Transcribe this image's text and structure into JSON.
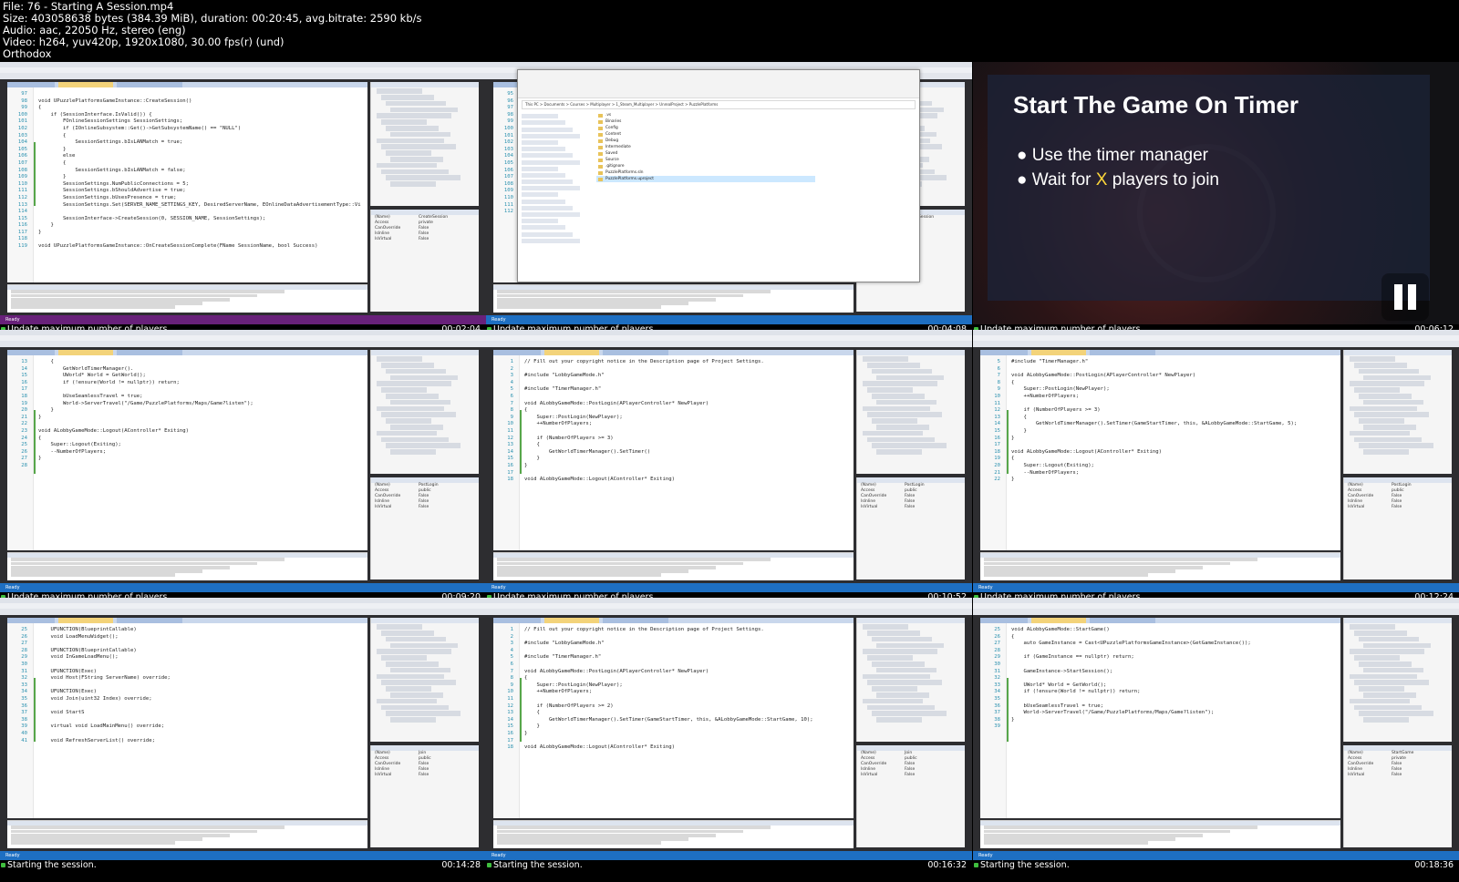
{
  "header": {
    "lines": [
      "File: 76 - Starting A Session.mp4",
      "Size: 403058638 bytes (384.39 MiB), duration: 00:20:45, avg.bitrate: 2590 kb/s",
      "Audio: aac, 22050 Hz, stereo (eng)",
      "Video: h264, yuv420p, 1920x1080, 30.00 fps(r) (und)",
      "Orthodox"
    ]
  },
  "tiles": [
    {
      "caption": "Update maximum number of players.",
      "timestamp": "00:02:04",
      "kind": "vs",
      "status": "Ready",
      "code": [
        {
          "n": "97",
          "t": ""
        },
        {
          "n": "98",
          "t": "void UPuzzlePlatformsGameInstance::CreateSession()"
        },
        {
          "n": "99",
          "t": "{"
        },
        {
          "n": "100",
          "t": "    if (SessionInterface.IsValid()) {"
        },
        {
          "n": "101",
          "t": "        FOnlineSessionSettings SessionSettings;"
        },
        {
          "n": "102",
          "t": "        if (IOnlineSubsystem::Get()->GetSubsystemName() == \"NULL\")"
        },
        {
          "n": "103",
          "t": "        {"
        },
        {
          "n": "104",
          "t": "            SessionSettings.bIsLANMatch = true;"
        },
        {
          "n": "105",
          "t": "        }"
        },
        {
          "n": "106",
          "t": "        else"
        },
        {
          "n": "107",
          "t": "        {"
        },
        {
          "n": "108",
          "t": "            SessionSettings.bIsLANMatch = false;"
        },
        {
          "n": "109",
          "t": "        }"
        },
        {
          "n": "110",
          "t": "        SessionSettings.NumPublicConnections = 5;"
        },
        {
          "n": "111",
          "t": "        SessionSettings.bShouldAdvertise = true;"
        },
        {
          "n": "112",
          "t": "        SessionSettings.bUsesPresence = true;"
        },
        {
          "n": "113",
          "t": "        SessionSettings.Set(SERVER_NAME_SETTINGS_KEY, DesiredServerName, EOnlineDataAdvertisementType::Vi"
        },
        {
          "n": "114",
          "t": ""
        },
        {
          "n": "115",
          "t": "        SessionInterface->CreateSession(0, SESSION_NAME, SessionSettings);"
        },
        {
          "n": "116",
          "t": "    }"
        },
        {
          "n": "117",
          "t": "}"
        },
        {
          "n": "118",
          "t": ""
        },
        {
          "n": "119",
          "t": "void UPuzzlePlatformsGameInstance::OnCreateSessionComplete(FName SessionName, bool Success)"
        }
      ],
      "props": [
        {
          "k": "(Name)",
          "v": "CreateSession"
        },
        {
          "k": "Access",
          "v": "private"
        },
        {
          "k": "CanOverride",
          "v": "False"
        },
        {
          "k": "IsInline",
          "v": "False"
        },
        {
          "k": "IsVirtual",
          "v": "False"
        }
      ]
    },
    {
      "caption": "Update maximum number of players.",
      "timestamp": "00:04:08",
      "kind": "explorer",
      "status": "Ready",
      "address": "This PC > Documents > Courses > Multiplayer > 1_Steam_Multiplayer > UnrealProject > PuzzlePlatforms",
      "files": [
        ".vs",
        "Binaries",
        "Config",
        "Content",
        "Debug",
        "Intermediate",
        "Saved",
        "Source",
        ".gitignore",
        "PuzzlePlatforms.sln",
        "PuzzlePlatforms.uproject"
      ],
      "code": [
        {
          "n": "95",
          "t": ""
        },
        {
          "n": "96",
          "t": ""
        },
        {
          "n": "97",
          "t": ""
        },
        {
          "n": "98",
          "t": ""
        },
        {
          "n": "99",
          "t": ""
        },
        {
          "n": "100",
          "t": ""
        },
        {
          "n": "101",
          "t": ""
        },
        {
          "n": "102",
          "t": ""
        },
        {
          "n": "103",
          "t": ""
        },
        {
          "n": "104",
          "t": ""
        },
        {
          "n": "105",
          "t": ""
        },
        {
          "n": "106",
          "t": ""
        },
        {
          "n": "107",
          "t": ""
        },
        {
          "n": "108",
          "t": ""
        },
        {
          "n": "109",
          "t": ""
        },
        {
          "n": "110",
          "t": ""
        },
        {
          "n": "111",
          "t": ""
        },
        {
          "n": "112",
          "t": ""
        }
      ],
      "props": [
        {
          "k": "(Name)",
          "v": "CreateSession"
        },
        {
          "k": "Access",
          "v": "private"
        },
        {
          "k": "IsInline",
          "v": "False"
        }
      ]
    },
    {
      "caption": "Update maximum number of players.",
      "timestamp": "00:06:12",
      "kind": "slide",
      "slide_title": "Start The Game On Timer",
      "bullets": [
        {
          "pre": "Use the timer manager",
          "hl": "",
          "post": ""
        },
        {
          "pre": "Wait for ",
          "hl": "X",
          "post": " players to join"
        }
      ]
    },
    {
      "caption": "Update maximum number of players.",
      "timestamp": "00:09:20",
      "kind": "vs",
      "status": "Ready",
      "code": [
        {
          "n": "13",
          "t": "    {"
        },
        {
          "n": "14",
          "t": "        GetWorldTimerManager()."
        },
        {
          "n": "15",
          "t": "        UWorld* World = GetWorld();"
        },
        {
          "n": "16",
          "t": "        if (!ensure(World != nullptr)) return;"
        },
        {
          "n": "17",
          "t": ""
        },
        {
          "n": "18",
          "t": "        bUseSeamlessTravel = true;"
        },
        {
          "n": "19",
          "t": "        World->ServerTravel(\"/Game/PuzzlePlatforms/Maps/Game?listen\");"
        },
        {
          "n": "20",
          "t": "    }"
        },
        {
          "n": "21",
          "t": "}"
        },
        {
          "n": "22",
          "t": ""
        },
        {
          "n": "23",
          "t": "void ALobbyGameMode::Logout(AController* Exiting)"
        },
        {
          "n": "24",
          "t": "{"
        },
        {
          "n": "25",
          "t": "    Super::Logout(Exiting);"
        },
        {
          "n": "26",
          "t": "    --NumberOfPlayers;"
        },
        {
          "n": "27",
          "t": "}"
        },
        {
          "n": "28",
          "t": ""
        }
      ],
      "props": [
        {
          "k": "(Name)",
          "v": "PostLogin"
        },
        {
          "k": "Access",
          "v": "public"
        },
        {
          "k": "CanOverride",
          "v": "False"
        },
        {
          "k": "IsInline",
          "v": "False"
        },
        {
          "k": "IsVirtual",
          "v": "False"
        }
      ]
    },
    {
      "caption": "Update maximum number of players.",
      "timestamp": "00:10:52",
      "kind": "vs",
      "status": "Ready",
      "code": [
        {
          "n": "1",
          "t": "// Fill out your copyright notice in the Description page of Project Settings."
        },
        {
          "n": "2",
          "t": ""
        },
        {
          "n": "3",
          "t": "#include \"LobbyGameMode.h\""
        },
        {
          "n": "4",
          "t": ""
        },
        {
          "n": "5",
          "t": "#include \"TimerManager.h\""
        },
        {
          "n": "6",
          "t": ""
        },
        {
          "n": "7",
          "t": "void ALobbyGameMode::PostLogin(APlayerController* NewPlayer)"
        },
        {
          "n": "8",
          "t": "{"
        },
        {
          "n": "9",
          "t": "    Super::PostLogin(NewPlayer);"
        },
        {
          "n": "10",
          "t": "    ++NumberOfPlayers;"
        },
        {
          "n": "11",
          "t": ""
        },
        {
          "n": "12",
          "t": "    if (NumberOfPlayers >= 3)"
        },
        {
          "n": "13",
          "t": "    {"
        },
        {
          "n": "14",
          "t": "        GetWorldTimerManager().SetTimer()"
        },
        {
          "n": "15",
          "t": "    }"
        },
        {
          "n": "16",
          "t": "}"
        },
        {
          "n": "17",
          "t": ""
        },
        {
          "n": "18",
          "t": "void ALobbyGameMode::Logout(AController* Exiting)"
        }
      ],
      "props": [
        {
          "k": "(Name)",
          "v": "PostLogin"
        },
        {
          "k": "Access",
          "v": "public"
        },
        {
          "k": "CanOverride",
          "v": "False"
        },
        {
          "k": "IsInline",
          "v": "False"
        },
        {
          "k": "IsVirtual",
          "v": "False"
        }
      ]
    },
    {
      "caption": "Update maximum number of players.",
      "timestamp": "00:12:24",
      "kind": "vs",
      "status": "Ready",
      "code": [
        {
          "n": "5",
          "t": "#include \"TimerManager.h\""
        },
        {
          "n": "6",
          "t": ""
        },
        {
          "n": "7",
          "t": "void ALobbyGameMode::PostLogin(APlayerController* NewPlayer)"
        },
        {
          "n": "8",
          "t": "{"
        },
        {
          "n": "9",
          "t": "    Super::PostLogin(NewPlayer);"
        },
        {
          "n": "10",
          "t": "    ++NumberOfPlayers;"
        },
        {
          "n": "11",
          "t": ""
        },
        {
          "n": "12",
          "t": "    if (NumberOfPlayers >= 3)"
        },
        {
          "n": "13",
          "t": "    {"
        },
        {
          "n": "14",
          "t": "        GetWorldTimerManager().SetTimer(GameStartTimer, this, &ALobbyGameMode::StartGame, 5);"
        },
        {
          "n": "15",
          "t": "    }"
        },
        {
          "n": "16",
          "t": "}"
        },
        {
          "n": "17",
          "t": ""
        },
        {
          "n": "18",
          "t": "void ALobbyGameMode::Logout(AController* Exiting)"
        },
        {
          "n": "19",
          "t": "{"
        },
        {
          "n": "20",
          "t": "    Super::Logout(Exiting);"
        },
        {
          "n": "21",
          "t": "    --NumberOfPlayers;"
        },
        {
          "n": "22",
          "t": "}"
        }
      ],
      "props": [
        {
          "k": "(Name)",
          "v": "PostLogin"
        },
        {
          "k": "Access",
          "v": "public"
        },
        {
          "k": "CanOverride",
          "v": "False"
        },
        {
          "k": "IsInline",
          "v": "False"
        },
        {
          "k": "IsVirtual",
          "v": "False"
        }
      ]
    },
    {
      "caption": "Starting the session.",
      "timestamp": "00:14:28",
      "kind": "vs",
      "status": "Ready",
      "code": [
        {
          "n": "25",
          "t": "    UFUNCTION(BlueprintCallable)"
        },
        {
          "n": "26",
          "t": "    void LoadMenuWidget();"
        },
        {
          "n": "27",
          "t": ""
        },
        {
          "n": "28",
          "t": "    UFUNCTION(BlueprintCallable)"
        },
        {
          "n": "29",
          "t": "    void InGameLoadMenu();"
        },
        {
          "n": "30",
          "t": ""
        },
        {
          "n": "31",
          "t": "    UFUNCTION(Exec)"
        },
        {
          "n": "32",
          "t": "    void Host(FString ServerName) override;"
        },
        {
          "n": "33",
          "t": ""
        },
        {
          "n": "34",
          "t": "    UFUNCTION(Exec)"
        },
        {
          "n": "35",
          "t": "    void Join(uint32 Index) override;"
        },
        {
          "n": "36",
          "t": ""
        },
        {
          "n": "37",
          "t": "    void StartS"
        },
        {
          "n": "38",
          "t": ""
        },
        {
          "n": "39",
          "t": "    virtual void LoadMainMenu() override;"
        },
        {
          "n": "40",
          "t": ""
        },
        {
          "n": "41",
          "t": "    void RefreshServerList() override;"
        }
      ],
      "props": [
        {
          "k": "(Name)",
          "v": "Join"
        },
        {
          "k": "Access",
          "v": "public"
        },
        {
          "k": "CanOverride",
          "v": "False"
        },
        {
          "k": "IsInline",
          "v": "False"
        },
        {
          "k": "IsVirtual",
          "v": "False"
        }
      ]
    },
    {
      "caption": "Starting the session.",
      "timestamp": "00:16:32",
      "kind": "vs",
      "status": "Ready",
      "code": [
        {
          "n": "1",
          "t": "// Fill out your copyright notice in the Description page of Project Settings."
        },
        {
          "n": "2",
          "t": ""
        },
        {
          "n": "3",
          "t": "#include \"LobbyGameMode.h\""
        },
        {
          "n": "4",
          "t": ""
        },
        {
          "n": "5",
          "t": "#include \"TimerManager.h\""
        },
        {
          "n": "6",
          "t": ""
        },
        {
          "n": "7",
          "t": "void ALobbyGameMode::PostLogin(APlayerController* NewPlayer)"
        },
        {
          "n": "8",
          "t": "{"
        },
        {
          "n": "9",
          "t": "    Super::PostLogin(NewPlayer);"
        },
        {
          "n": "10",
          "t": "    ++NumberOfPlayers;"
        },
        {
          "n": "11",
          "t": ""
        },
        {
          "n": "12",
          "t": "    if (NumberOfPlayers >= 2)"
        },
        {
          "n": "13",
          "t": "    {"
        },
        {
          "n": "14",
          "t": "        GetWorldTimerManager().SetTimer(GameStartTimer, this, &ALobbyGameMode::StartGame, 10);"
        },
        {
          "n": "15",
          "t": "    }"
        },
        {
          "n": "16",
          "t": "}"
        },
        {
          "n": "17",
          "t": ""
        },
        {
          "n": "18",
          "t": "void ALobbyGameMode::Logout(AController* Exiting)"
        }
      ],
      "props": [
        {
          "k": "(Name)",
          "v": "Join"
        },
        {
          "k": "Access",
          "v": "public"
        },
        {
          "k": "CanOverride",
          "v": "False"
        },
        {
          "k": "IsInline",
          "v": "False"
        },
        {
          "k": "IsVirtual",
          "v": "False"
        }
      ]
    },
    {
      "caption": "Starting the session.",
      "timestamp": "00:18:36",
      "kind": "vs",
      "status": "Ready",
      "code": [
        {
          "n": "25",
          "t": "void ALobbyGameMode::StartGame()"
        },
        {
          "n": "26",
          "t": "{"
        },
        {
          "n": "27",
          "t": "    auto GameInstance = Cast<UPuzzlePlatformsGameInstance>(GetGameInstance());"
        },
        {
          "n": "28",
          "t": ""
        },
        {
          "n": "29",
          "t": "    if (GameInstance == nullptr) return;"
        },
        {
          "n": "30",
          "t": ""
        },
        {
          "n": "31",
          "t": "    GameInstance->StartSession();"
        },
        {
          "n": "32",
          "t": ""
        },
        {
          "n": "33",
          "t": "    UWorld* World = GetWorld();"
        },
        {
          "n": "34",
          "t": "    if (!ensure(World != nullptr)) return;"
        },
        {
          "n": "35",
          "t": ""
        },
        {
          "n": "36",
          "t": "    bUseSeamlessTravel = true;"
        },
        {
          "n": "37",
          "t": "    World->ServerTravel(\"/Game/PuzzlePlatforms/Maps/Game?listen\");"
        },
        {
          "n": "38",
          "t": "}"
        },
        {
          "n": "39",
          "t": ""
        }
      ],
      "props": [
        {
          "k": "(Name)",
          "v": "StartGame"
        },
        {
          "k": "Access",
          "v": "private"
        },
        {
          "k": "CanOverride",
          "v": "False"
        },
        {
          "k": "IsInline",
          "v": "False"
        },
        {
          "k": "IsVirtual",
          "v": "False"
        }
      ]
    }
  ],
  "colors": {
    "status_bar": "#1e6fc2",
    "status_bar_purple": "#68217a",
    "accent_yellow": "#ffd83a"
  }
}
